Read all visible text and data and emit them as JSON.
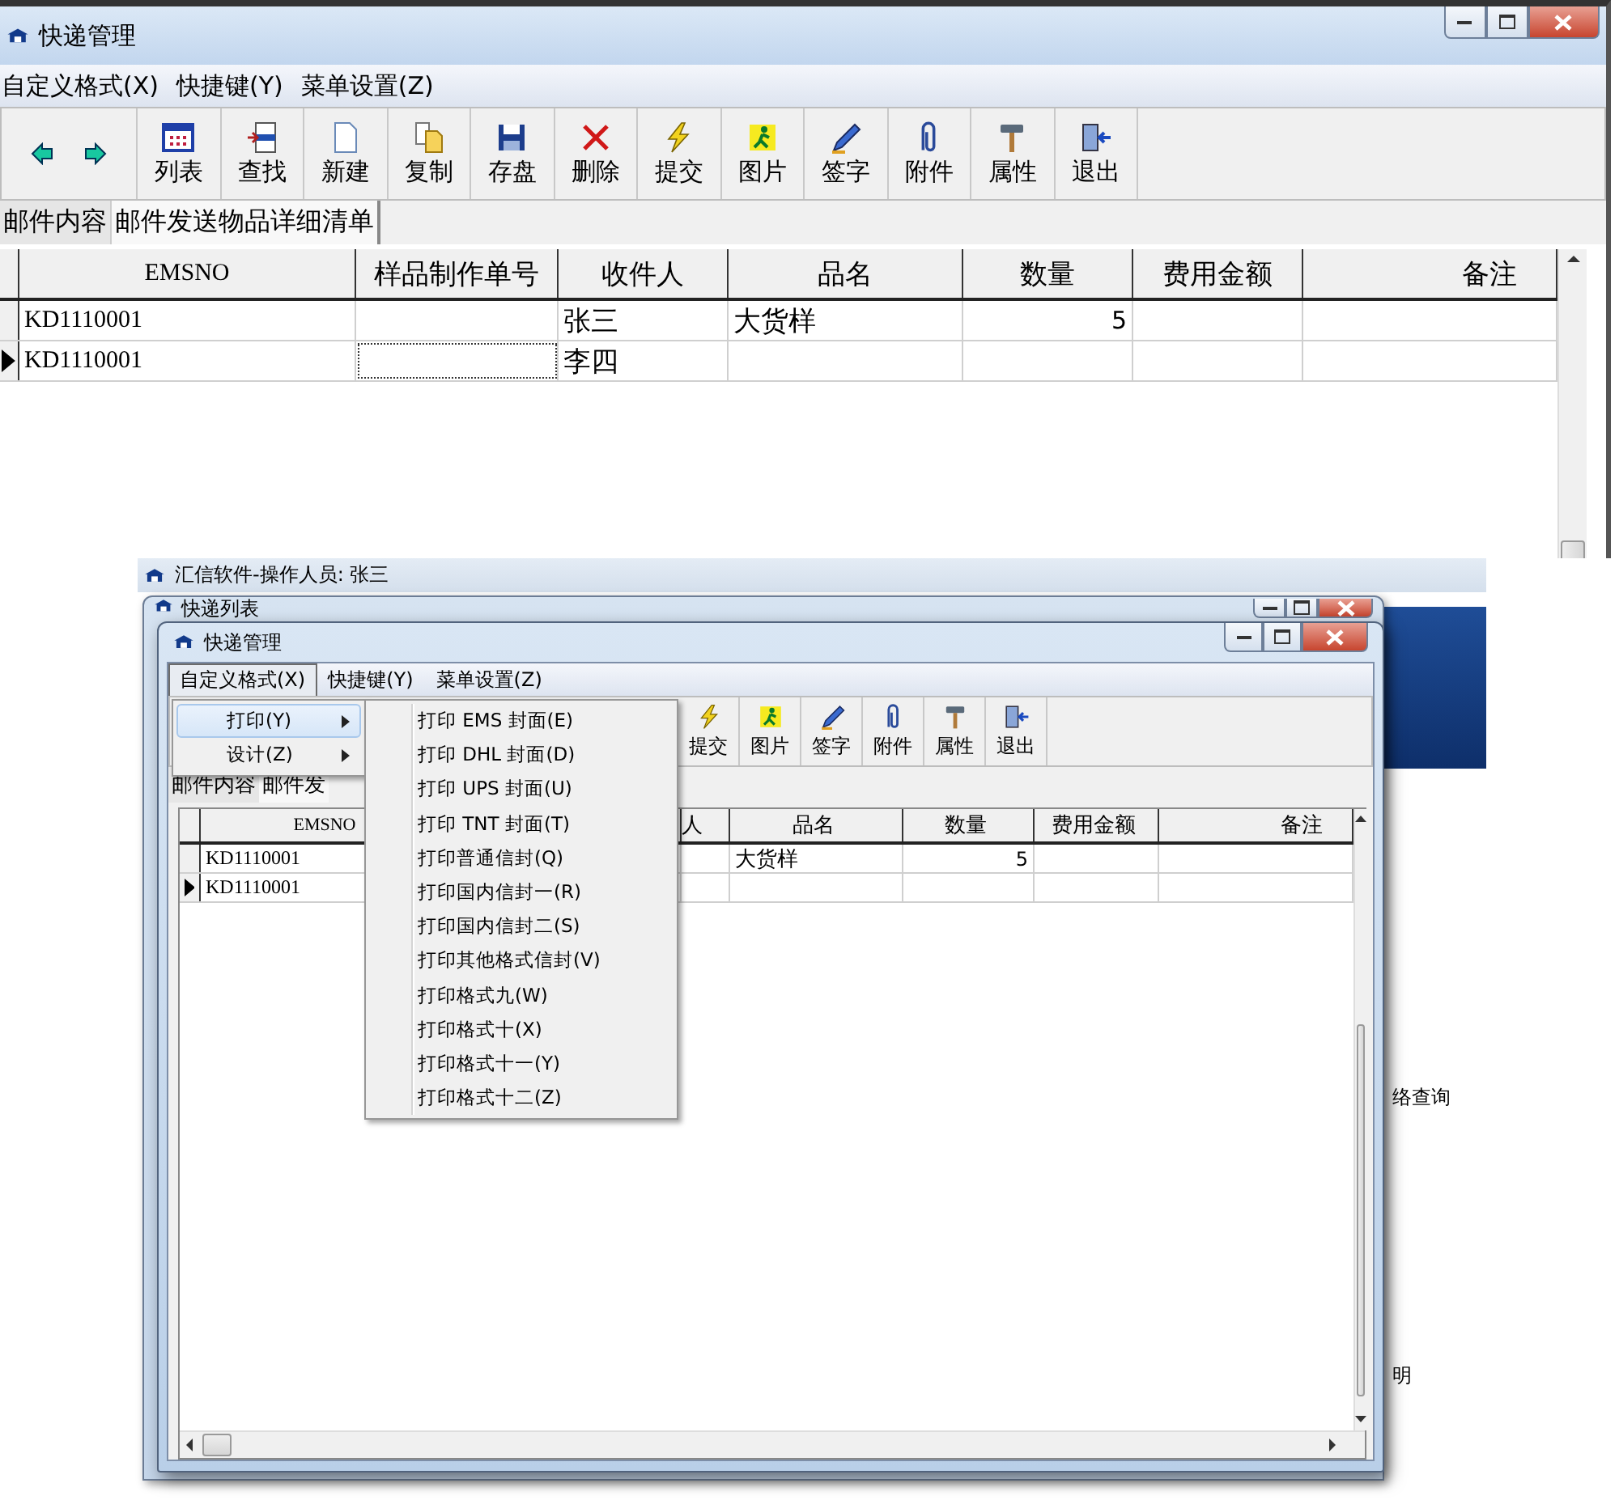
{
  "top_window": {
    "title": "快递管理",
    "menu": [
      "自定义格式(X)",
      "快捷键(Y)",
      "菜单设置(Z)"
    ],
    "toolbar": [
      "列表",
      "查找",
      "新建",
      "复制",
      "存盘",
      "删除",
      "提交",
      "图片",
      "签字",
      "附件",
      "属性",
      "退出"
    ],
    "tabs": [
      {
        "label": "邮件内容",
        "selected": false
      },
      {
        "label": "邮件发送物品详细清单",
        "selected": true
      }
    ],
    "grid": {
      "columns": [
        "EMSNO",
        "样品制作单号",
        "收件人",
        "品名",
        "数量",
        "费用金额",
        "备注"
      ],
      "rows": [
        {
          "emsno": "KD1110001",
          "recipient": "张三",
          "product": "大货样",
          "quantity": "5",
          "current": false
        },
        {
          "emsno": "KD1110001",
          "recipient": "李四",
          "current": true
        }
      ]
    }
  },
  "app_window": {
    "title": "汇信软件-操作人员: 张三",
    "side_texts": [
      "络查询",
      "明"
    ]
  },
  "list_window": {
    "title": "快递列表"
  },
  "front_window": {
    "title": "快递管理",
    "menu": [
      {
        "label": "自定义格式(X)",
        "selected": true
      },
      {
        "label": "快捷键(Y)",
        "selected": false
      },
      {
        "label": "菜单设置(Z)",
        "selected": false
      }
    ],
    "toolbar": [
      "提交",
      "图片",
      "签字",
      "附件",
      "属性",
      "退出"
    ],
    "tabs": [
      {
        "label": "邮件内容",
        "selected": false
      },
      {
        "label": "邮件发",
        "selected": true
      }
    ],
    "grid": {
      "columns": [
        "EMSNO",
        "人",
        "品名",
        "数量",
        "费用金额",
        "备注"
      ],
      "rows": [
        {
          "emsno": "KD1110001",
          "product": "大货样",
          "quantity": "5",
          "current": false
        },
        {
          "emsno": "KD1110001",
          "current": true
        }
      ]
    },
    "menu_popup": {
      "items": [
        {
          "label": "打印(Y)",
          "selected": true
        },
        {
          "label": "设计(Z)",
          "selected": false
        }
      ],
      "submenu": [
        "打印 EMS 封面(E)",
        "打印 DHL 封面(D)",
        "打印 UPS 封面(U)",
        "打印 TNT 封面(T)",
        "打印普通信封(Q)",
        "打印国内信封一(R)",
        "打印国内信封二(S)",
        "打印其他格式信封(V)",
        "打印格式九(W)",
        "打印格式十(X)",
        "打印格式十一(Y)",
        "打印格式十二(Z)"
      ]
    }
  }
}
